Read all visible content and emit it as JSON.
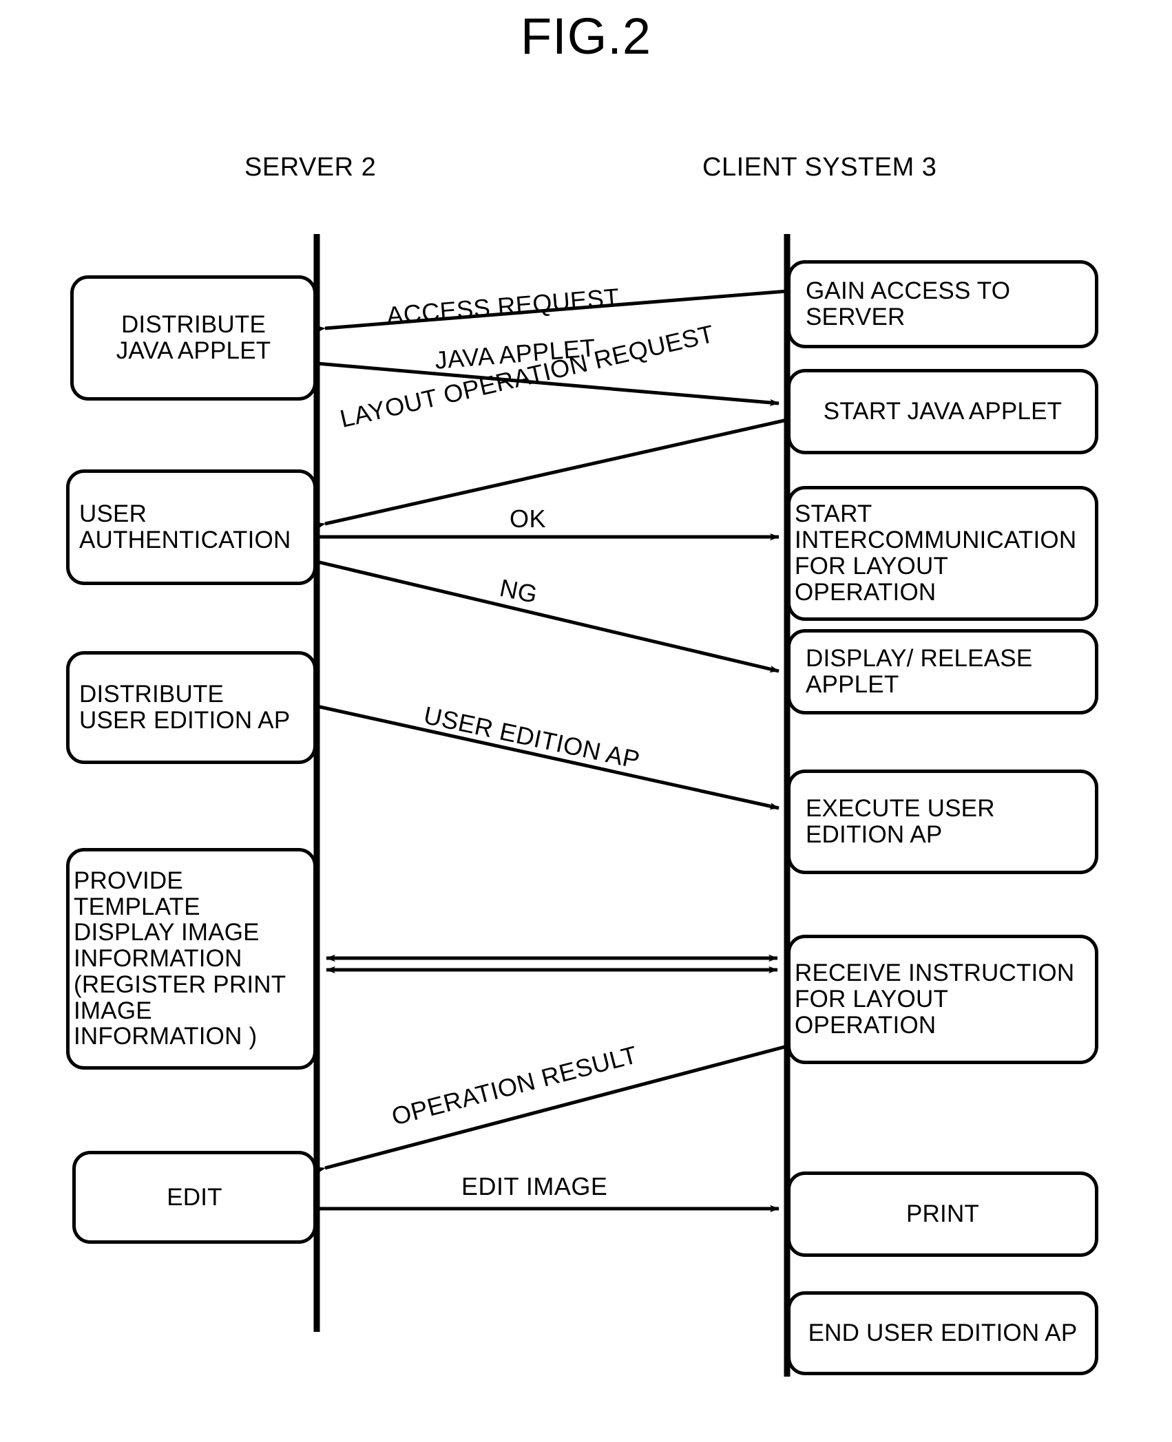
{
  "figure": {
    "title": "FIG.2",
    "type": "sequence-diagram"
  },
  "columns": {
    "left": {
      "header": "SERVER 2"
    },
    "right": {
      "header": "CLIENT SYSTEM 3"
    }
  },
  "server_nodes": [
    {
      "id": "distribute-java-applet",
      "lines": [
        "DISTRIBUTE",
        "JAVA APPLET"
      ]
    },
    {
      "id": "user-authentication",
      "lines": [
        "USER",
        "AUTHENTICATION"
      ]
    },
    {
      "id": "distribute-user-edition-ap",
      "lines": [
        "DISTRIBUTE",
        "USER EDITION AP"
      ]
    },
    {
      "id": "provide-template",
      "lines": [
        "PROVIDE",
        "TEMPLATE",
        "DISPLAY IMAGE",
        "INFORMATION",
        "(REGISTER PRINT",
        "IMAGE",
        "INFORMATION )"
      ]
    },
    {
      "id": "edit",
      "lines": [
        "EDIT"
      ]
    }
  ],
  "client_nodes": [
    {
      "id": "gain-access-to-server",
      "lines": [
        "GAIN ACCESS TO",
        "SERVER"
      ]
    },
    {
      "id": "start-java-applet",
      "lines": [
        "START JAVA APPLET"
      ]
    },
    {
      "id": "start-intercommunication",
      "lines": [
        "START",
        "INTERCOMMUNICATION",
        "FOR LAYOUT",
        "OPERATION"
      ]
    },
    {
      "id": "display-release-applet",
      "lines": [
        "DISPLAY/ RELEASE",
        "APPLET"
      ]
    },
    {
      "id": "execute-user-edition-ap",
      "lines": [
        "EXECUTE USER",
        "EDITION AP"
      ]
    },
    {
      "id": "receive-instruction",
      "lines": [
        "RECEIVE INSTRUCTION",
        "FOR LAYOUT",
        "OPERATION"
      ]
    },
    {
      "id": "print",
      "lines": [
        "PRINT"
      ]
    },
    {
      "id": "end-user-edition-ap",
      "lines": [
        "END USER EDITION AP"
      ]
    }
  ],
  "messages": [
    {
      "id": "access-request",
      "label": "ACCESS REQUEST",
      "direction": "client-to-server"
    },
    {
      "id": "java-applet",
      "label": "JAVA APPLET",
      "direction": "server-to-client"
    },
    {
      "id": "layout-operation-request",
      "label_lines": [
        "LAYOUT OPERATION",
        "REQUEST"
      ],
      "direction": "client-to-server"
    },
    {
      "id": "ok",
      "label": "OK",
      "direction": "server-to-client"
    },
    {
      "id": "ng",
      "label": "NG",
      "direction": "server-to-client"
    },
    {
      "id": "user-edition-ap",
      "label": "USER EDITION AP",
      "direction": "server-to-client"
    },
    {
      "id": "layout-exchange",
      "label": "",
      "direction": "bidirectional"
    },
    {
      "id": "operation-result",
      "label": "OPERATION RESULT",
      "direction": "client-to-server"
    },
    {
      "id": "edit-image",
      "label": "EDIT IMAGE",
      "direction": "server-to-client"
    }
  ],
  "colors": {
    "ink": "#000000",
    "paper": "#ffffff"
  }
}
